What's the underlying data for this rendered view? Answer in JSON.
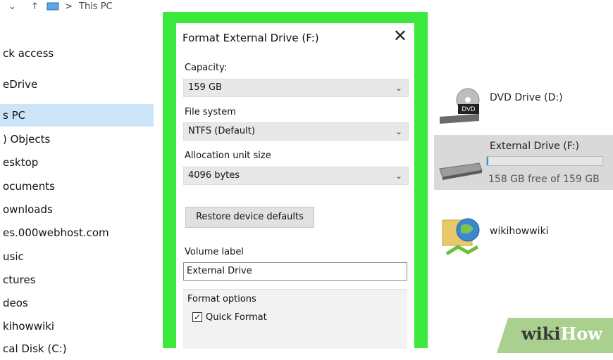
{
  "breadcrumb": {
    "down": "⌄",
    "up": "↑",
    "location": "This PC"
  },
  "sidebar": {
    "items": [
      {
        "label": "ck access"
      },
      {
        "label": "eDrive"
      },
      {
        "label": "s PC",
        "selected": true
      },
      {
        "label": ") Objects"
      },
      {
        "label": "esktop"
      },
      {
        "label": "ocuments"
      },
      {
        "label": "ownloads"
      },
      {
        "label": "es.000webhost.com"
      },
      {
        "label": "usic"
      },
      {
        "label": "ctures"
      },
      {
        "label": "deos"
      },
      {
        "label": "kihowwiki"
      },
      {
        "label": "cal Disk (C:)"
      }
    ]
  },
  "drives": {
    "dvd": {
      "name": "DVD Drive (D:)",
      "icon": "dvd-drive-icon"
    },
    "external": {
      "name": "External Drive (F:)",
      "free": "158 GB free of 159 GB",
      "used_fraction": 0.01,
      "icon": "hard-drive-icon"
    },
    "network": {
      "name": "wikihowwiki",
      "icon": "network-location-icon"
    }
  },
  "dialog": {
    "title": "Format External Drive (F:)",
    "close": "✕",
    "capacity_label": "Capacity:",
    "capacity_value": "159 GB",
    "filesystem_label": "File system",
    "filesystem_value": "NTFS (Default)",
    "allocation_label": "Allocation unit size",
    "allocation_value": "4096 bytes",
    "restore_button": "Restore device defaults",
    "volume_label": "Volume label",
    "volume_value": "External Drive",
    "format_options_label": "Format options",
    "quick_format_label": "Quick Format",
    "quick_format_checked": true
  },
  "watermark": {
    "part1": "wiki",
    "part2": "How"
  },
  "colors": {
    "highlight": "#3be83b",
    "selection": "#cce4f7",
    "drive_selected": "#d9d9d9"
  }
}
